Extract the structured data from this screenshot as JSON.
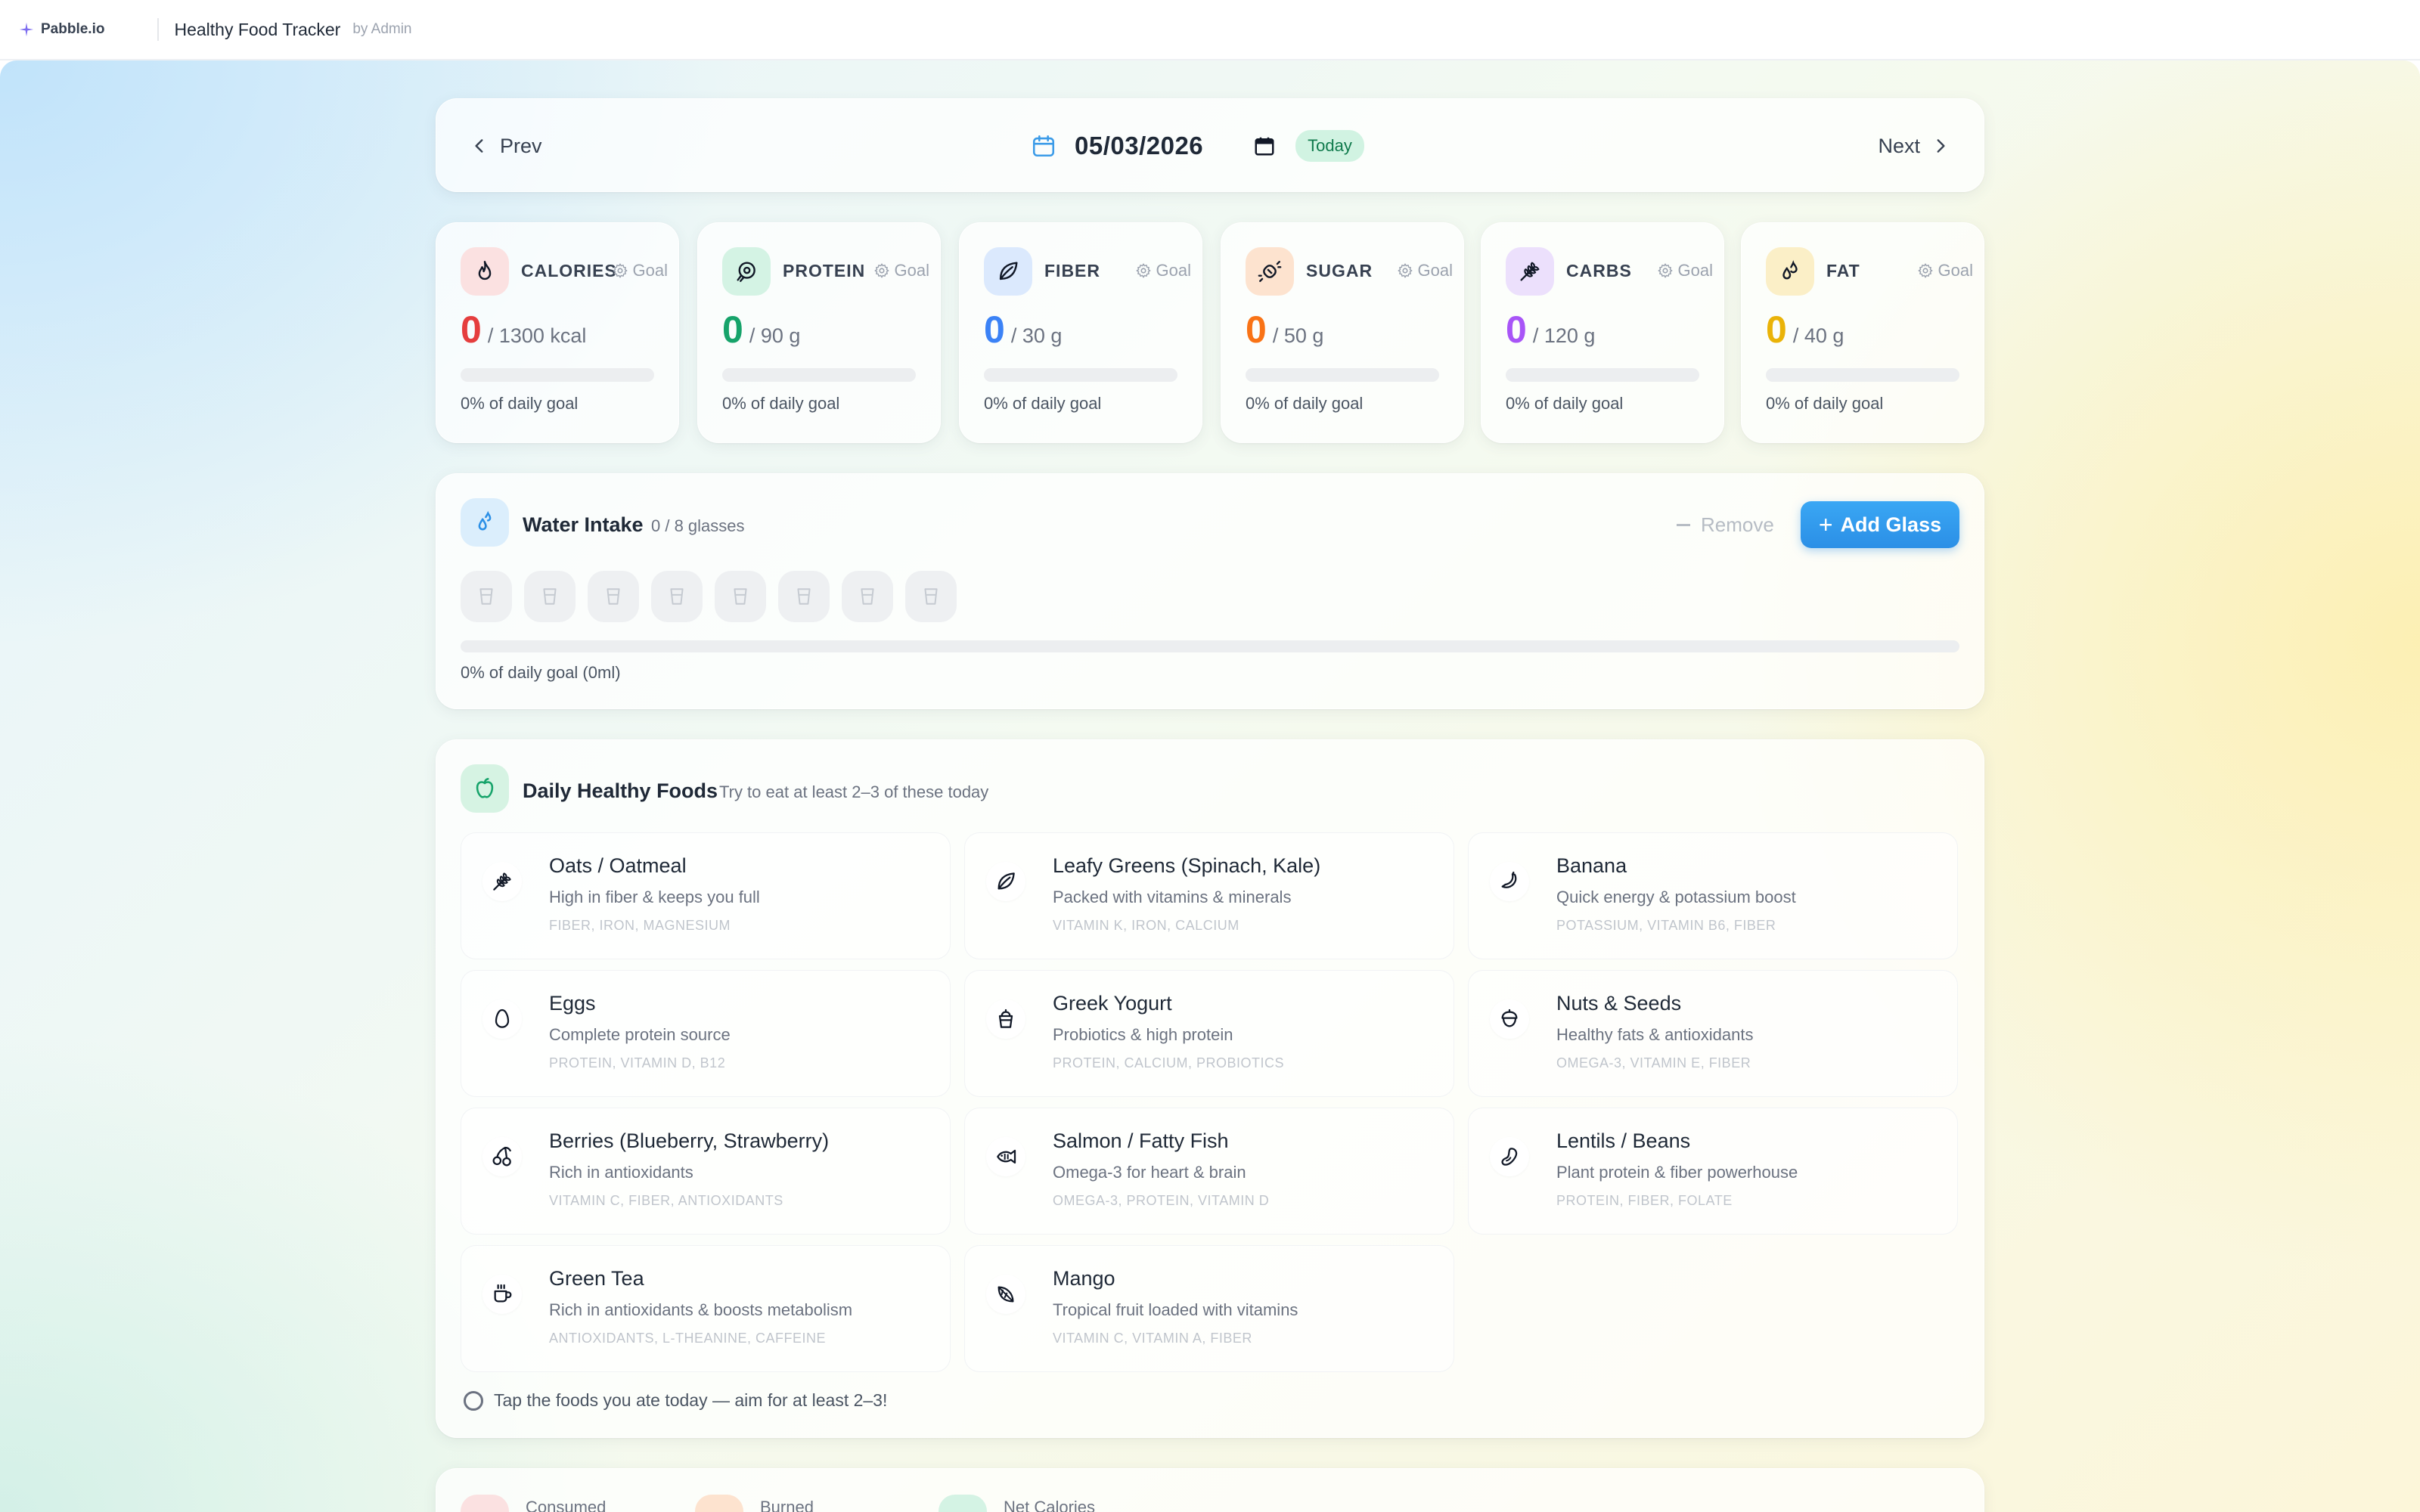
{
  "topbar": {
    "brand": "Pabble.io",
    "app_title": "Healthy Food Tracker",
    "app_by": "by Admin"
  },
  "datenav": {
    "prev_label": "Prev",
    "next_label": "Next",
    "date": "05/03/2026",
    "today_label": "Today"
  },
  "nutrients": [
    {
      "label": "CALORIES",
      "goal_label": "Goal",
      "value": "0",
      "unit": "/ 1300 kcal",
      "progress": 0,
      "pct_text": "0% of daily goal",
      "color": "#e53e3e",
      "icon_bg": "#fbe1e1",
      "icon": "flame-icon"
    },
    {
      "label": "PROTEIN",
      "goal_label": "Goal",
      "value": "0",
      "unit": "/ 90 g",
      "progress": 0,
      "pct_text": "0% of daily goal",
      "color": "#16a36a",
      "icon_bg": "#d4f3e4",
      "icon": "beef-icon"
    },
    {
      "label": "FIBER",
      "goal_label": "Goal",
      "value": "0",
      "unit": "/ 30 g",
      "progress": 0,
      "pct_text": "0% of daily goal",
      "color": "#3b82f6",
      "icon_bg": "#dbe9fd",
      "icon": "leaf-icon"
    },
    {
      "label": "SUGAR",
      "goal_label": "Goal",
      "value": "0",
      "unit": "/ 50 g",
      "progress": 0,
      "pct_text": "0% of daily goal",
      "color": "#f97316",
      "icon_bg": "#fde3cf",
      "icon": "candy-icon"
    },
    {
      "label": "CARBS",
      "goal_label": "Goal",
      "value": "0",
      "unit": "/ 120 g",
      "progress": 0,
      "pct_text": "0% of daily goal",
      "color": "#a855f7",
      "icon_bg": "#ece0fc",
      "icon": "wheat-icon"
    },
    {
      "label": "FAT",
      "goal_label": "Goal",
      "value": "0",
      "unit": "/ 40 g",
      "progress": 0,
      "pct_text": "0% of daily goal",
      "color": "#eab308",
      "icon_bg": "#fbefc7",
      "icon": "droplets-icon"
    }
  ],
  "water": {
    "title": "Water Intake",
    "count": "0 / 8 glasses",
    "remove_label": "Remove",
    "add_label": "Add Glass",
    "glasses_total": 8,
    "glasses_filled": 0,
    "progress": 0,
    "pct_text": "0% of daily goal (0ml)"
  },
  "foods": {
    "title": "Daily Healthy Foods",
    "subtitle": "Try to eat at least 2–3 of these today",
    "hint": "Tap the foods you ate today — aim for at least 2–3!",
    "items": [
      {
        "name": "Oats / Oatmeal",
        "desc": "High in fiber & keeps you full",
        "tags": "FIBER, IRON, MAGNESIUM",
        "icon": "wheat-icon"
      },
      {
        "name": "Leafy Greens (Spinach, Kale)",
        "desc": "Packed with vitamins & minerals",
        "tags": "VITAMIN K, IRON, CALCIUM",
        "icon": "leaf-icon"
      },
      {
        "name": "Banana",
        "desc": "Quick energy & potassium boost",
        "tags": "POTASSIUM, VITAMIN B6, FIBER",
        "icon": "banana-icon"
      },
      {
        "name": "Eggs",
        "desc": "Complete protein source",
        "tags": "PROTEIN, VITAMIN D, B12",
        "icon": "egg-icon"
      },
      {
        "name": "Greek Yogurt",
        "desc": "Probiotics & high protein",
        "tags": "PROTEIN, CALCIUM, PROBIOTICS",
        "icon": "cup-icon"
      },
      {
        "name": "Nuts & Seeds",
        "desc": "Healthy fats & antioxidants",
        "tags": "OMEGA-3, VITAMIN E, FIBER",
        "icon": "nut-icon"
      },
      {
        "name": "Berries (Blueberry, Strawberry)",
        "desc": "Rich in antioxidants",
        "tags": "VITAMIN C, FIBER, ANTIOXIDANTS",
        "icon": "cherry-icon"
      },
      {
        "name": "Salmon / Fatty Fish",
        "desc": "Omega-3 for heart & brain",
        "tags": "OMEGA-3, PROTEIN, VITAMIN D",
        "icon": "fish-icon"
      },
      {
        "name": "Lentils / Beans",
        "desc": "Plant protein & fiber powerhouse",
        "tags": "PROTEIN, FIBER, FOLATE",
        "icon": "bean-icon"
      },
      {
        "name": "Green Tea",
        "desc": "Rich in antioxidants & boosts metabolism",
        "tags": "ANTIOXIDANTS, L-THEANINE, CAFFEINE",
        "icon": "coffee-cup-icon"
      },
      {
        "name": "Mango",
        "desc": "Tropical fruit loaded with vitamins",
        "tags": "VITAMIN C, VITAMIN A, FIBER",
        "icon": "citrus-icon"
      }
    ]
  },
  "summary": {
    "items": [
      {
        "label": "Consumed",
        "color": "#fbe1e1"
      },
      {
        "label": "Burned",
        "color": "#fde3cf"
      },
      {
        "label": "Net Calories",
        "color": "#d4f3e4"
      }
    ]
  }
}
